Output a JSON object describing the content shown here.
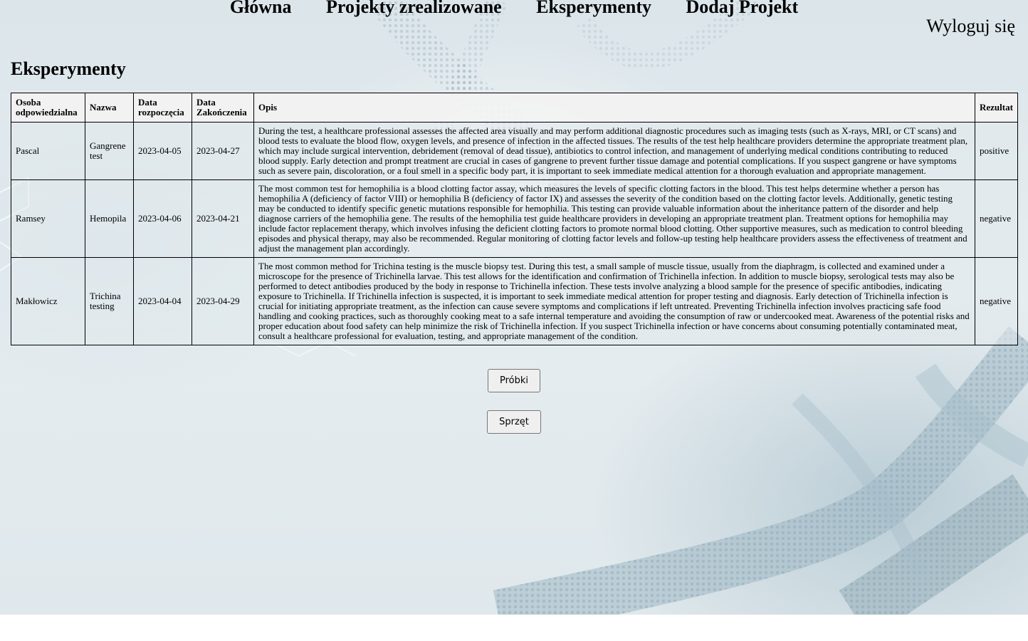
{
  "nav": {
    "items": [
      "Główna",
      "Projekty zrealizowane",
      "Eksperymenty",
      "Dodaj Projekt"
    ],
    "logout_label": "Wyloguj się"
  },
  "page": {
    "title": "Eksperymenty"
  },
  "table": {
    "headers": {
      "osoba": "Osoba odpowiedzialna",
      "nazwa": "Nazwa",
      "data_start": "Data rozpoczęcia",
      "data_end": "Data Zakończenia",
      "opis": "Opis",
      "rezultat": "Rezultat"
    },
    "rows": [
      {
        "osoba": "Pascal",
        "nazwa": "Gangrene test",
        "data_start": "2023-04-05",
        "data_end": "2023-04-27",
        "opis": "During the test, a healthcare professional assesses the affected area visually and may perform additional diagnostic procedures such as imaging tests (such as X-rays, MRI, or CT scans) and blood tests to evaluate the blood flow, oxygen levels, and presence of infection in the affected tissues. The results of the test help healthcare providers determine the appropriate treatment plan, which may include surgical intervention, debridement (removal of dead tissue), antibiotics to control infection, and management of underlying medical conditions contributing to reduced blood supply. Early detection and prompt treatment are crucial in cases of gangrene to prevent further tissue damage and potential complications. If you suspect gangrene or have symptoms such as severe pain, discoloration, or a foul smell in a specific body part, it is important to seek immediate medical attention for a thorough evaluation and appropriate management.",
        "rezultat": "positive"
      },
      {
        "osoba": "Ramsey",
        "nazwa": "Hemopila",
        "data_start": "2023-04-06",
        "data_end": "2023-04-21",
        "opis": "The most common test for hemophilia is a blood clotting factor assay, which measures the levels of specific clotting factors in the blood. This test helps determine whether a person has hemophilia A (deficiency of factor VIII) or hemophilia B (deficiency of factor IX) and assesses the severity of the condition based on the clotting factor levels. Additionally, genetic testing may be conducted to identify specific genetic mutations responsible for hemophilia. This testing can provide valuable information about the inheritance pattern of the disorder and help diagnose carriers of the hemophilia gene. The results of the hemophilia test guide healthcare providers in developing an appropriate treatment plan. Treatment options for hemophilia may include factor replacement therapy, which involves infusing the deficient clotting factors to promote normal blood clotting. Other supportive measures, such as medication to control bleeding episodes and physical therapy, may also be recommended. Regular monitoring of clotting factor levels and follow-up testing help healthcare providers assess the effectiveness of treatment and adjust the management plan accordingly.",
        "rezultat": "negative"
      },
      {
        "osoba": "Makłowicz",
        "nazwa": "Trichina testing",
        "data_start": "2023-04-04",
        "data_end": "2023-04-29",
        "opis": "The most common method for Trichina testing is the muscle biopsy test. During this test, a small sample of muscle tissue, usually from the diaphragm, is collected and examined under a microscope for the presence of Trichinella larvae. This test allows for the identification and confirmation of Trichinella infection. In addition to muscle biopsy, serological tests may also be performed to detect antibodies produced by the body in response to Trichinella infection. These tests involve analyzing a blood sample for the presence of specific antibodies, indicating exposure to Trichinella. If Trichinella infection is suspected, it is important to seek immediate medical attention for proper testing and diagnosis. Early detection of Trichinella infection is crucial for initiating appropriate treatment, as the infection can cause severe symptoms and complications if left untreated. Preventing Trichinella infection involves practicing safe food handling and cooking practices, such as thoroughly cooking meat to a safe internal temperature and avoiding the consumption of raw or undercooked meat. Awareness of the potential risks and proper education about food safety can help minimize the risk of Trichinella infection. If you suspect Trichinella infection or have concerns about consuming potentially contaminated meat, consult a healthcare professional for evaluation, testing, and appropriate management of the condition.",
        "rezultat": "negative"
      }
    ]
  },
  "buttons": {
    "probki_label": "Próbki",
    "sprzet_label": "Sprzęt"
  }
}
